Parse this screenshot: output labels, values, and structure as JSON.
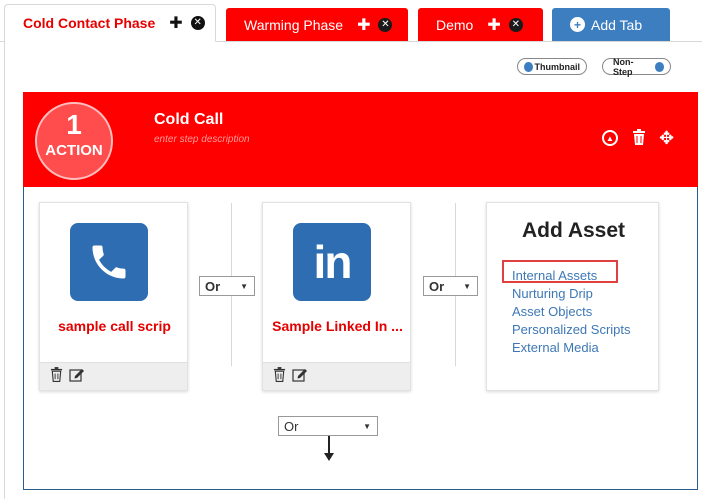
{
  "tabs": [
    {
      "label": "Cold Contact Phase",
      "active": true
    },
    {
      "label": "Warming Phase",
      "active": false
    },
    {
      "label": "Demo",
      "active": false
    }
  ],
  "add_tab_label": "Add Tab",
  "toggles": {
    "thumbnail": "Thumbnail",
    "non_step": "Non-Step"
  },
  "step": {
    "number": "1",
    "badge_label": "ACTION",
    "title": "Cold Call",
    "description_placeholder": "enter step description"
  },
  "assets": [
    {
      "label": "sample call scrip",
      "icon": "phone-icon"
    },
    {
      "label": "Sample Linked In ...",
      "icon": "linkedin-icon"
    }
  ],
  "or_label": "Or",
  "add_asset": {
    "title": "Add Asset",
    "items": [
      "Internal Assets",
      "Nurturing Drip",
      "Asset Objects",
      "Personalized Scripts",
      "External Media"
    ],
    "highlighted": "Internal Assets"
  },
  "colors": {
    "brand_red": "#ff0000",
    "brand_blue": "#3d7ec1",
    "link": "#3d78b5"
  }
}
